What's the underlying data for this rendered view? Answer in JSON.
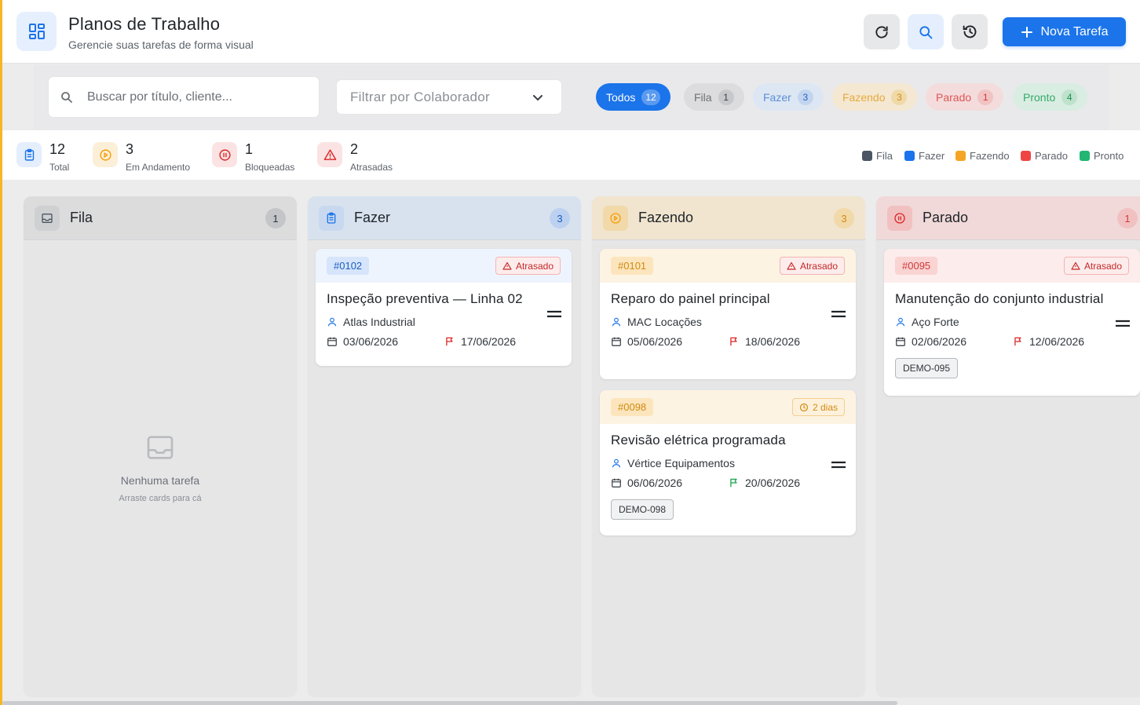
{
  "header": {
    "title": "Planos de Trabalho",
    "subtitle": "Gerencie suas tarefas de forma visual",
    "new_task_label": "Nova Tarefa",
    "icons": [
      "grid-icon",
      "refresh-icon",
      "search-icon",
      "history-icon",
      "plus-icon"
    ]
  },
  "filters": {
    "search_placeholder": "Buscar por título, cliente...",
    "collaborator_placeholder": "Filtrar por Colaborador",
    "chips": [
      {
        "label": "Todos",
        "count": "12",
        "active": true
      },
      {
        "label": "Fila",
        "count": "1"
      },
      {
        "label": "Fazer",
        "count": "3"
      },
      {
        "label": "Fazendo",
        "count": "3"
      },
      {
        "label": "Parado",
        "count": "1"
      },
      {
        "label": "Pronto",
        "count": "4"
      }
    ]
  },
  "stats": [
    {
      "value": "12",
      "label": "Total",
      "icon": "clipboard-icon"
    },
    {
      "value": "3",
      "label": "Em Andamento",
      "icon": "play-circle-icon"
    },
    {
      "value": "1",
      "label": "Bloqueadas",
      "icon": "pause-circle-icon"
    },
    {
      "value": "2",
      "label": "Atrasadas",
      "icon": "warning-icon"
    }
  ],
  "legend": [
    {
      "label": "Fila",
      "color": "#4b5563"
    },
    {
      "label": "Fazer",
      "color": "#1b74ea"
    },
    {
      "label": "Fazendo",
      "color": "#f5a524"
    },
    {
      "label": "Parado",
      "color": "#ef4444"
    },
    {
      "label": "Pronto",
      "color": "#22b573"
    }
  ],
  "columns": [
    {
      "title": "Fila",
      "count": "1",
      "empty_title": "Nenhuma tarefa",
      "empty_hint": "Arraste cards para cá"
    },
    {
      "title": "Fazer",
      "count": "3",
      "cards": [
        {
          "code": "#0102",
          "badge": "Atrasado",
          "title": "Inspeção preventiva — Linha 02",
          "client": "Atlas Industrial",
          "start": "03/06/2026",
          "due": "17/06/2026"
        }
      ]
    },
    {
      "title": "Fazendo",
      "count": "3",
      "cards": [
        {
          "code": "#0101",
          "badge": "Atrasado",
          "title": "Reparo do painel principal",
          "client": "MAC Locações",
          "start": "05/06/2026",
          "due": "18/06/2026"
        },
        {
          "code": "#0098",
          "badge": "2 dias",
          "title": "Revisão elétrica programada",
          "client": "Vértice Equipamentos",
          "start": "06/06/2026",
          "due": "20/06/2026",
          "tag": "DEMO-098"
        }
      ]
    },
    {
      "title": "Parado",
      "count": "1",
      "cards": [
        {
          "code": "#0095",
          "badge": "Atrasado",
          "title": "Manutenção do conjunto industrial",
          "client": "Aço Forte",
          "start": "02/06/2026",
          "due": "12/06/2026",
          "tag": "DEMO-095"
        }
      ]
    }
  ],
  "colors": {
    "primary": "#1b74ea",
    "late": "#dc2626",
    "warn": "#f59e0b",
    "ok": "#16a34a"
  }
}
